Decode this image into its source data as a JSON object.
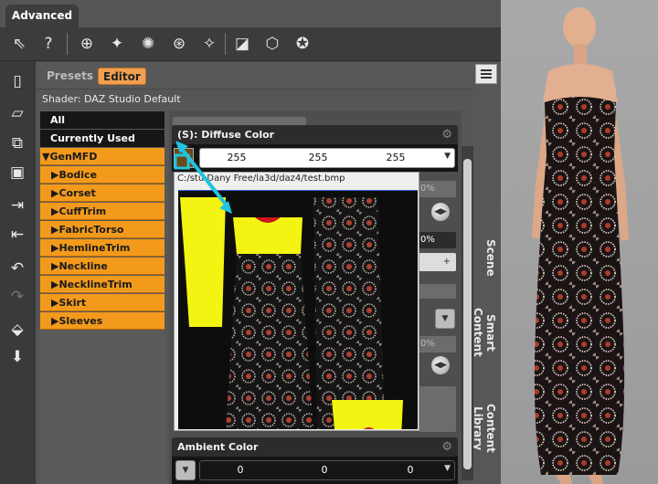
{
  "tabs": {
    "advanced": "Advanced"
  },
  "toolbar": {
    "icons": [
      "pointer-help-icon",
      "help-icon",
      "camera-add-icon",
      "spotlight-icon",
      "pointlight-icon",
      "distantlight-icon",
      "flashlight-icon",
      "camera-icon",
      "primitive-icon",
      "node-wand-icon"
    ]
  },
  "left_icons": [
    "new-file-icon",
    "open-icon",
    "merge-icon",
    "save-icon",
    "import-icon",
    "export-icon",
    "undo-icon",
    "redo-icon",
    "content-icon",
    "download-icon"
  ],
  "panel": {
    "presets_tab": "Presets",
    "editor_tab": "Editor",
    "shader": "Shader: DAZ Studio Default"
  },
  "categories": [
    {
      "label": "All",
      "style": "black"
    },
    {
      "label": "Currently Used",
      "style": "black"
    },
    {
      "label": "▼GenMFD",
      "style": "group"
    },
    {
      "label": "▶Bodice",
      "style": "sub"
    },
    {
      "label": "▶Corset",
      "style": "sub"
    },
    {
      "label": "▶CuffTrim",
      "style": "sub"
    },
    {
      "label": "▶FabricTorso",
      "style": "sub"
    },
    {
      "label": "▶HemlineTrim",
      "style": "sub"
    },
    {
      "label": "▶Neckline",
      "style": "sub"
    },
    {
      "label": "▶NecklineTrim",
      "style": "sub"
    },
    {
      "label": "▶Skirt",
      "style": "sub"
    },
    {
      "label": "▶Sleeves",
      "style": "sub"
    }
  ],
  "diffuse": {
    "title": "(S): Diffuse Color",
    "r": "255",
    "g": "255",
    "b": "255"
  },
  "ghost_values": {
    "p1": "0%",
    "p2": "0%",
    "p3": "0%"
  },
  "texture_popup": {
    "path": "C:/stu Dany Free/la3d/daz4/test.bmp"
  },
  "ambient": {
    "title": "Ambient Color",
    "r": "0",
    "g": "0",
    "b": "0"
  },
  "side_tabs": [
    "Scene",
    "Smart Content",
    "Content Library"
  ],
  "colors": {
    "accent": "#f39a1c",
    "panel": "#565656",
    "arrow": "#20c4e0"
  }
}
